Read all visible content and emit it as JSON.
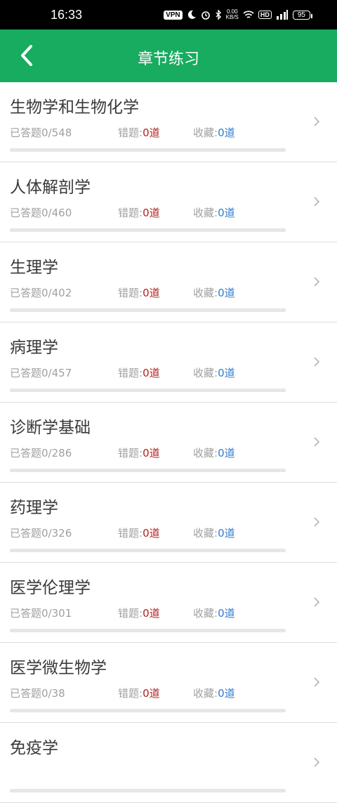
{
  "status_bar": {
    "time": "16:33",
    "vpn": "VPN",
    "speed_value": "0.00",
    "speed_unit": "KB/S",
    "hd": "HD",
    "network": "5G",
    "battery": "95"
  },
  "header": {
    "title": "章节练习",
    "back_icon": "chevron-left-icon",
    "background": "#17ac5f"
  },
  "labels": {
    "answered_prefix": "已答题",
    "wrong_label": "错题:",
    "fav_label": "收藏:",
    "unit": "道"
  },
  "colors": {
    "wrong_value": "#b01f1f",
    "fav_value": "#2f7ad1"
  },
  "chapters": [
    {
      "name": "生物学和生物化学",
      "answered": "0/548",
      "wrong": "0",
      "fav": "0",
      "progress": 0
    },
    {
      "name": "人体解剖学",
      "answered": "0/460",
      "wrong": "0",
      "fav": "0",
      "progress": 0
    },
    {
      "name": "生理学",
      "answered": "0/402",
      "wrong": "0",
      "fav": "0",
      "progress": 0
    },
    {
      "name": "病理学",
      "answered": "0/457",
      "wrong": "0",
      "fav": "0",
      "progress": 0
    },
    {
      "name": "诊断学基础",
      "answered": "0/286",
      "wrong": "0",
      "fav": "0",
      "progress": 0
    },
    {
      "name": "药理学",
      "answered": "0/326",
      "wrong": "0",
      "fav": "0",
      "progress": 0
    },
    {
      "name": "医学伦理学",
      "answered": "0/301",
      "wrong": "0",
      "fav": "0",
      "progress": 0
    },
    {
      "name": "医学微生物学",
      "answered": "0/38",
      "wrong": "0",
      "fav": "0",
      "progress": 0
    },
    {
      "name": "免疫学",
      "answered": "",
      "wrong": "",
      "fav": "",
      "progress": 0
    }
  ]
}
